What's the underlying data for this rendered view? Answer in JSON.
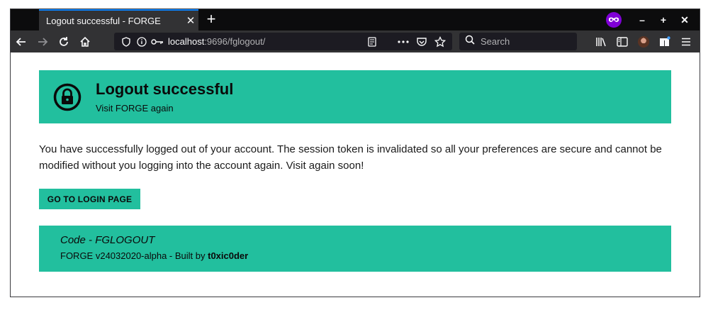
{
  "browser": {
    "tab_title": "Logout successful - FORGE",
    "tab_close": "✕",
    "new_tab": "+",
    "url_host": "localhost",
    "url_rest": ":9696/fglogout/",
    "search_placeholder": "Search",
    "window_controls": {
      "minimize": "–",
      "maximize": "+",
      "close": "✕"
    }
  },
  "page": {
    "title": "Logout successful",
    "subtitle": "Visit FORGE again",
    "message": "You have successfully logged out of your account. The session token is invalidated so all your preferences are secure and cannot be modified without you logging into the account again. Visit again soon!",
    "login_button": "GO TO LOGIN PAGE",
    "footer_code": "Code - FGLOGOUT",
    "footer_version": "FORGE v24032020-alpha - Built by ",
    "footer_author": "t0xic0der"
  },
  "colors": {
    "accent": "#22bf9e",
    "chrome_dark": "#0c0c0d",
    "chrome_toolbar": "#323234",
    "tab_highlight": "#0a84ff",
    "private_badge": "#8000d7"
  },
  "icons": [
    "back-icon",
    "forward-icon",
    "reload-icon",
    "home-icon",
    "shield-icon",
    "info-icon",
    "key-icon",
    "reader-icon",
    "more-icon",
    "pocket-icon",
    "star-icon",
    "search-icon",
    "library-icon",
    "sidebar-icon",
    "avatar",
    "extensions-icon",
    "menu-icon",
    "lock-icon",
    "private-browsing-icon"
  ]
}
